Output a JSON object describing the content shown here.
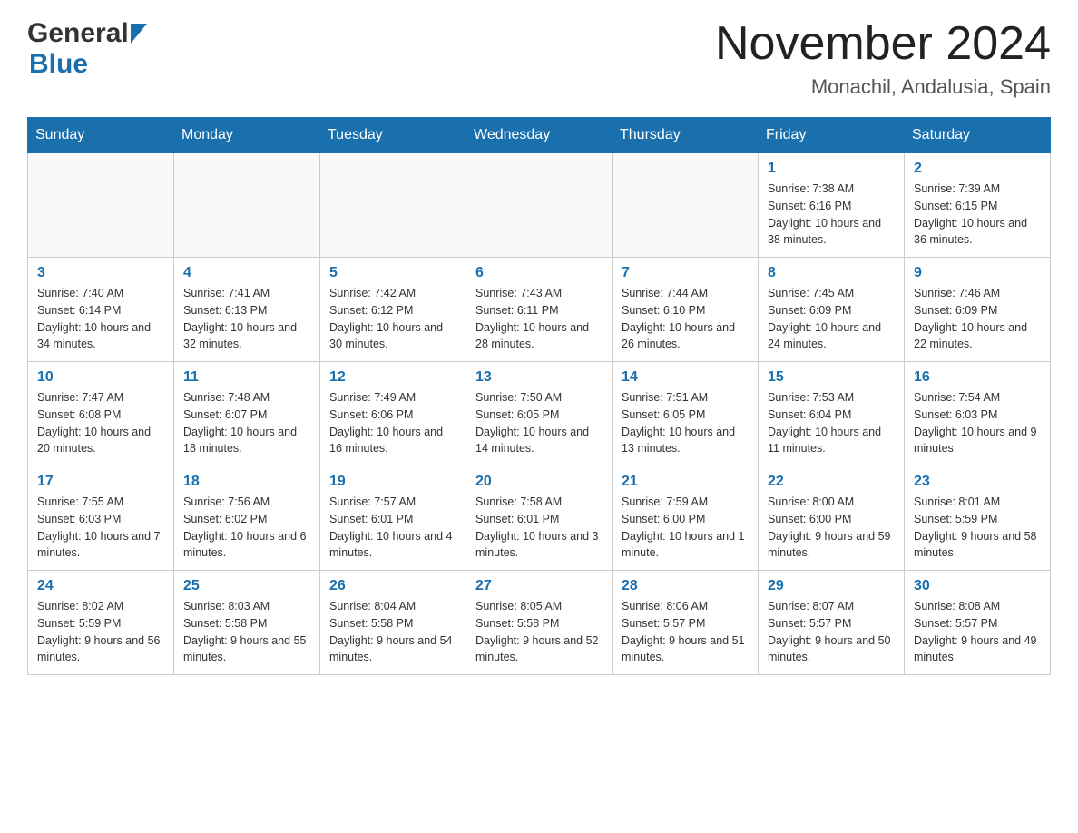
{
  "header": {
    "logo_general": "General",
    "logo_blue": "Blue",
    "title": "November 2024",
    "subtitle": "Monachil, Andalusia, Spain"
  },
  "weekdays": [
    "Sunday",
    "Monday",
    "Tuesday",
    "Wednesday",
    "Thursday",
    "Friday",
    "Saturday"
  ],
  "weeks": [
    {
      "days": [
        {
          "number": "",
          "info": ""
        },
        {
          "number": "",
          "info": ""
        },
        {
          "number": "",
          "info": ""
        },
        {
          "number": "",
          "info": ""
        },
        {
          "number": "",
          "info": ""
        },
        {
          "number": "1",
          "info": "Sunrise: 7:38 AM\nSunset: 6:16 PM\nDaylight: 10 hours and 38 minutes."
        },
        {
          "number": "2",
          "info": "Sunrise: 7:39 AM\nSunset: 6:15 PM\nDaylight: 10 hours and 36 minutes."
        }
      ]
    },
    {
      "days": [
        {
          "number": "3",
          "info": "Sunrise: 7:40 AM\nSunset: 6:14 PM\nDaylight: 10 hours and 34 minutes."
        },
        {
          "number": "4",
          "info": "Sunrise: 7:41 AM\nSunset: 6:13 PM\nDaylight: 10 hours and 32 minutes."
        },
        {
          "number": "5",
          "info": "Sunrise: 7:42 AM\nSunset: 6:12 PM\nDaylight: 10 hours and 30 minutes."
        },
        {
          "number": "6",
          "info": "Sunrise: 7:43 AM\nSunset: 6:11 PM\nDaylight: 10 hours and 28 minutes."
        },
        {
          "number": "7",
          "info": "Sunrise: 7:44 AM\nSunset: 6:10 PM\nDaylight: 10 hours and 26 minutes."
        },
        {
          "number": "8",
          "info": "Sunrise: 7:45 AM\nSunset: 6:09 PM\nDaylight: 10 hours and 24 minutes."
        },
        {
          "number": "9",
          "info": "Sunrise: 7:46 AM\nSunset: 6:09 PM\nDaylight: 10 hours and 22 minutes."
        }
      ]
    },
    {
      "days": [
        {
          "number": "10",
          "info": "Sunrise: 7:47 AM\nSunset: 6:08 PM\nDaylight: 10 hours and 20 minutes."
        },
        {
          "number": "11",
          "info": "Sunrise: 7:48 AM\nSunset: 6:07 PM\nDaylight: 10 hours and 18 minutes."
        },
        {
          "number": "12",
          "info": "Sunrise: 7:49 AM\nSunset: 6:06 PM\nDaylight: 10 hours and 16 minutes."
        },
        {
          "number": "13",
          "info": "Sunrise: 7:50 AM\nSunset: 6:05 PM\nDaylight: 10 hours and 14 minutes."
        },
        {
          "number": "14",
          "info": "Sunrise: 7:51 AM\nSunset: 6:05 PM\nDaylight: 10 hours and 13 minutes."
        },
        {
          "number": "15",
          "info": "Sunrise: 7:53 AM\nSunset: 6:04 PM\nDaylight: 10 hours and 11 minutes."
        },
        {
          "number": "16",
          "info": "Sunrise: 7:54 AM\nSunset: 6:03 PM\nDaylight: 10 hours and 9 minutes."
        }
      ]
    },
    {
      "days": [
        {
          "number": "17",
          "info": "Sunrise: 7:55 AM\nSunset: 6:03 PM\nDaylight: 10 hours and 7 minutes."
        },
        {
          "number": "18",
          "info": "Sunrise: 7:56 AM\nSunset: 6:02 PM\nDaylight: 10 hours and 6 minutes."
        },
        {
          "number": "19",
          "info": "Sunrise: 7:57 AM\nSunset: 6:01 PM\nDaylight: 10 hours and 4 minutes."
        },
        {
          "number": "20",
          "info": "Sunrise: 7:58 AM\nSunset: 6:01 PM\nDaylight: 10 hours and 3 minutes."
        },
        {
          "number": "21",
          "info": "Sunrise: 7:59 AM\nSunset: 6:00 PM\nDaylight: 10 hours and 1 minute."
        },
        {
          "number": "22",
          "info": "Sunrise: 8:00 AM\nSunset: 6:00 PM\nDaylight: 9 hours and 59 minutes."
        },
        {
          "number": "23",
          "info": "Sunrise: 8:01 AM\nSunset: 5:59 PM\nDaylight: 9 hours and 58 minutes."
        }
      ]
    },
    {
      "days": [
        {
          "number": "24",
          "info": "Sunrise: 8:02 AM\nSunset: 5:59 PM\nDaylight: 9 hours and 56 minutes."
        },
        {
          "number": "25",
          "info": "Sunrise: 8:03 AM\nSunset: 5:58 PM\nDaylight: 9 hours and 55 minutes."
        },
        {
          "number": "26",
          "info": "Sunrise: 8:04 AM\nSunset: 5:58 PM\nDaylight: 9 hours and 54 minutes."
        },
        {
          "number": "27",
          "info": "Sunrise: 8:05 AM\nSunset: 5:58 PM\nDaylight: 9 hours and 52 minutes."
        },
        {
          "number": "28",
          "info": "Sunrise: 8:06 AM\nSunset: 5:57 PM\nDaylight: 9 hours and 51 minutes."
        },
        {
          "number": "29",
          "info": "Sunrise: 8:07 AM\nSunset: 5:57 PM\nDaylight: 9 hours and 50 minutes."
        },
        {
          "number": "30",
          "info": "Sunrise: 8:08 AM\nSunset: 5:57 PM\nDaylight: 9 hours and 49 minutes."
        }
      ]
    }
  ]
}
